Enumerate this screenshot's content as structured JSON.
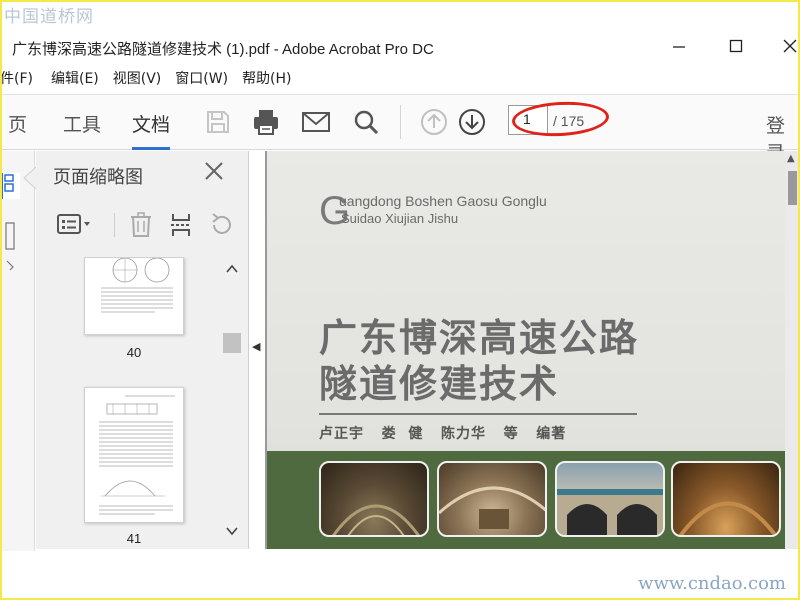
{
  "watermarks": {
    "top": "中国道桥网",
    "bottom": "www.cndao.com"
  },
  "window": {
    "title": "广东博深高速公路隧道修建技术 (1).pdf - Adobe Acrobat Pro DC"
  },
  "menu": [
    "件(F)",
    "编辑(E)",
    "视图(V)",
    "窗口(W)",
    "帮助(H)"
  ],
  "tabs": {
    "home": "页",
    "tools": "工具",
    "document": "文档",
    "login": "登录"
  },
  "page_nav": {
    "current": "1",
    "total": "/ 175"
  },
  "thumb_panel": {
    "title": "页面缩略图",
    "pages": [
      {
        "label": "40"
      },
      {
        "label": "41"
      }
    ]
  },
  "cover": {
    "initial": "G",
    "en_line1": "uangdong Boshen Gaosu Gonglu",
    "en_line2": "Suidao Xiujian Jishu",
    "title_line1": "广东博深高速公路",
    "title_line2": "隧道修建技术",
    "authors": "卢正宇   娄  健   陈力华   等   编著"
  },
  "colors": {
    "accent": "#2d6fd3",
    "highlight_circle": "#e0221a",
    "frame": "#f5e94a"
  }
}
